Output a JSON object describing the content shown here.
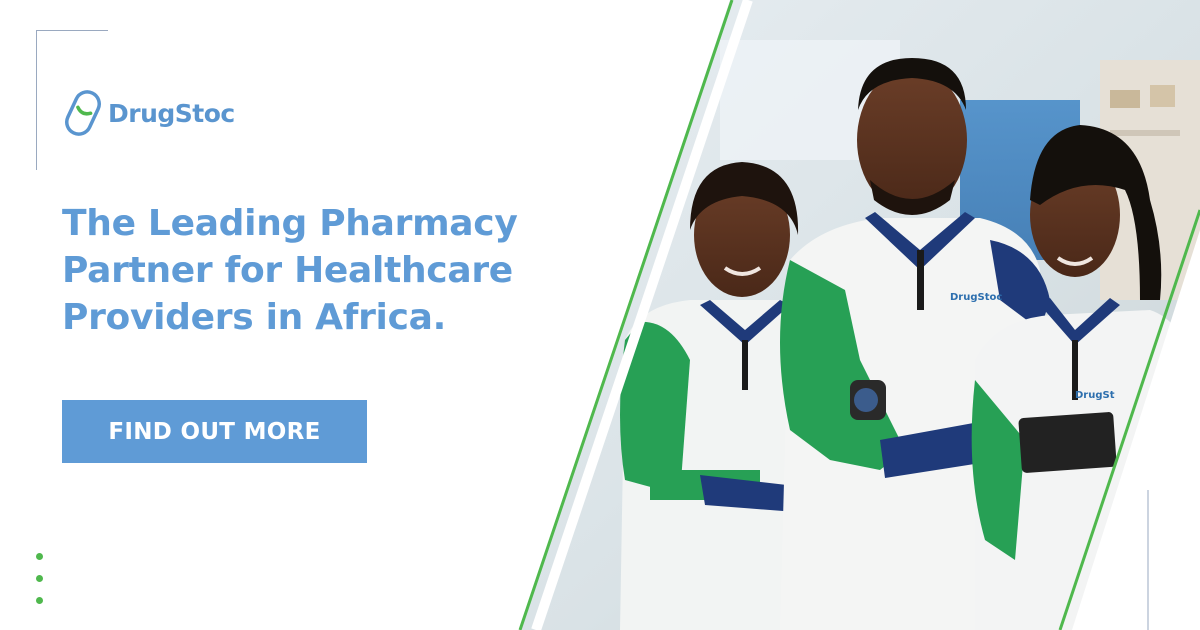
{
  "brand": {
    "name": "DrugStoc",
    "primary_color": "#5f9bd6",
    "accent_color": "#4fb84d"
  },
  "hero": {
    "headline_lines": [
      "The Leading Pharmacy",
      "Partner for Healthcare",
      "Providers in Africa."
    ]
  },
  "cta": {
    "label": "FIND OUT MORE"
  },
  "photo": {
    "subject": "three pharmacy staff in green and white DrugStoc uniforms",
    "uniform_logo_text": "DrugStoc"
  },
  "decor": {
    "dots_count": 3
  }
}
